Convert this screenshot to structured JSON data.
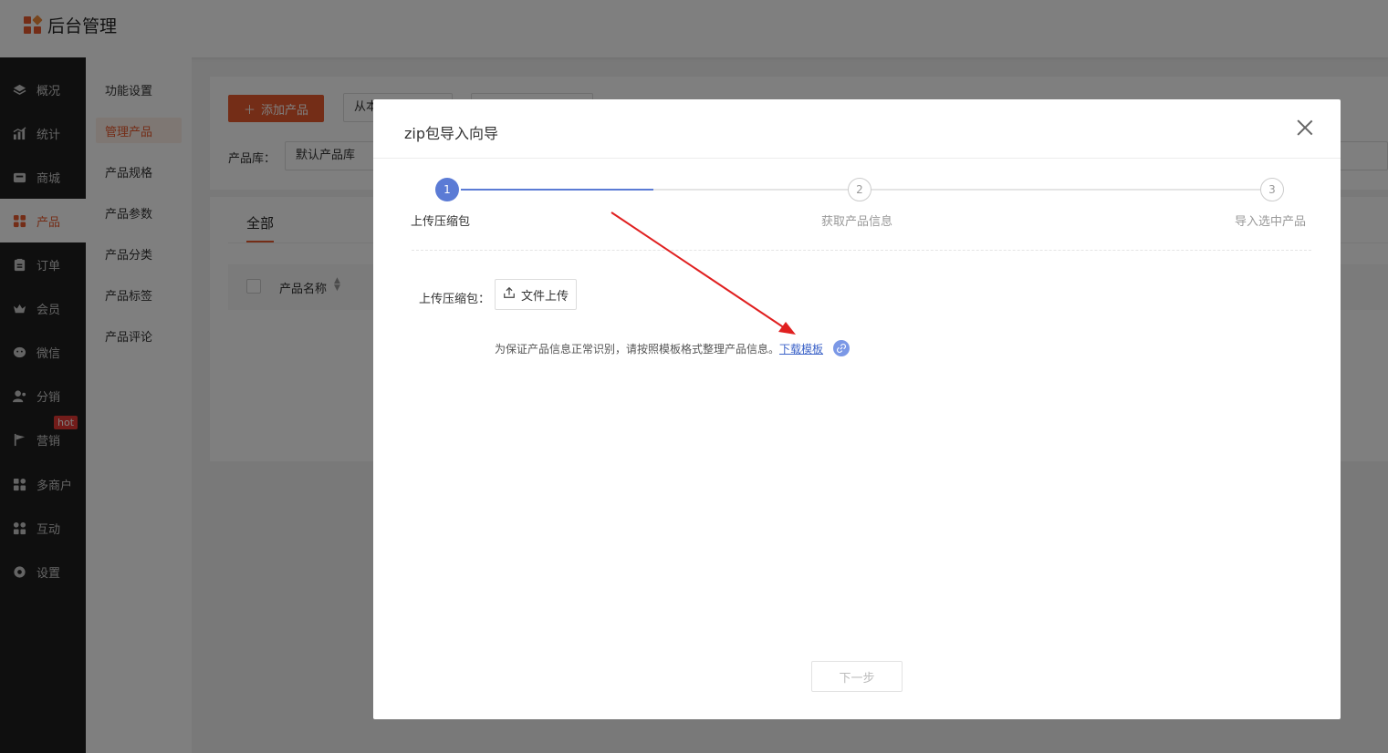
{
  "header": {
    "brand_title": "后台管理"
  },
  "sidebar": {
    "items": [
      {
        "label": "概况",
        "icon": "layers-icon"
      },
      {
        "label": "统计",
        "icon": "chart-icon"
      },
      {
        "label": "商城",
        "icon": "store-icon"
      },
      {
        "label": "产品",
        "icon": "product-icon"
      },
      {
        "label": "订单",
        "icon": "order-icon"
      },
      {
        "label": "会员",
        "icon": "crown-icon"
      },
      {
        "label": "微信",
        "icon": "wechat-icon"
      },
      {
        "label": "分销",
        "icon": "distribution-icon"
      },
      {
        "label": "营销",
        "icon": "flag-icon",
        "badge": "hot"
      },
      {
        "label": "多商户",
        "icon": "merchant-icon"
      },
      {
        "label": "互动",
        "icon": "interact-icon"
      },
      {
        "label": "设置",
        "icon": "gear-icon"
      }
    ],
    "active": "产品"
  },
  "submenu": {
    "items": [
      {
        "label": "功能设置"
      },
      {
        "label": "管理产品"
      },
      {
        "label": "产品规格"
      },
      {
        "label": "产品参数"
      },
      {
        "label": "产品分类"
      },
      {
        "label": "产品标签"
      },
      {
        "label": "产品评论"
      }
    ],
    "active": "管理产品"
  },
  "main": {
    "add_button": "添加产品",
    "from_button": "从本",
    "library_label": "产品库：",
    "library_value": "默认产品库",
    "tab_all": "全部",
    "col_product_name": "产品名称"
  },
  "modal": {
    "title": "zip包导入向导",
    "steps": [
      {
        "num": "1",
        "label": "上传压缩包"
      },
      {
        "num": "2",
        "label": "获取产品信息"
      },
      {
        "num": "3",
        "label": "导入选中产品"
      }
    ],
    "current_step": 1,
    "upload_label": "上传压缩包：",
    "upload_button": "文件上传",
    "hint_text": "为保证产品信息正常识别，请按照模板格式整理产品信息。",
    "download_link": "下载模板",
    "next_button": "下一步"
  },
  "colors": {
    "accent": "#e95b2e",
    "step_active": "#5b7bd5",
    "link": "#3b62c8",
    "sidebar_bg": "#1f1f1f",
    "annotation_arrow": "#e02020"
  }
}
